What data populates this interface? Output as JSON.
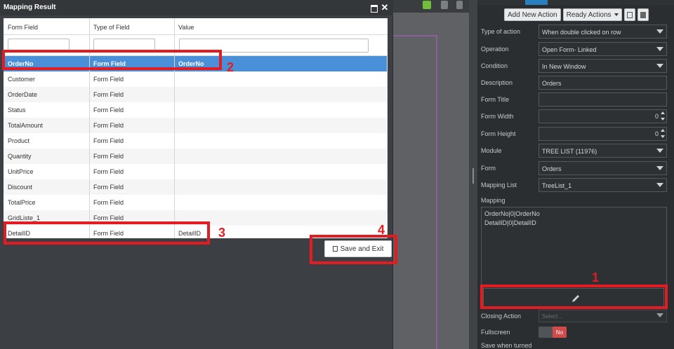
{
  "modal": {
    "title": "Mapping Result",
    "columns": [
      "Form Field",
      "Type of Field",
      "Value"
    ],
    "rows": [
      {
        "field": "OrderNo",
        "type": "Form Field",
        "value": "OrderNo",
        "selected": true
      },
      {
        "field": "Customer",
        "type": "Form Field",
        "value": ""
      },
      {
        "field": "OrderDate",
        "type": "Form Field",
        "value": ""
      },
      {
        "field": "Status",
        "type": "Form Field",
        "value": ""
      },
      {
        "field": "TotalAmount",
        "type": "Form Field",
        "value": ""
      },
      {
        "field": "Product",
        "type": "Form Field",
        "value": ""
      },
      {
        "field": "Quantity",
        "type": "Form Field",
        "value": ""
      },
      {
        "field": "UnitPrice",
        "type": "Form Field",
        "value": ""
      },
      {
        "field": "Discount",
        "type": "Form Field",
        "value": ""
      },
      {
        "field": "TotalPrice",
        "type": "Form Field",
        "value": ""
      },
      {
        "field": "GridListe_1",
        "type": "Form Field",
        "value": ""
      },
      {
        "field": "DetailID",
        "type": "Form Field",
        "value": "DetailID"
      }
    ],
    "save_label": "Save and Exit"
  },
  "panel": {
    "add_action_label": "Add New Action",
    "ready_actions_label": "Ready Actions",
    "props": {
      "type_of_action": {
        "label": "Type of action",
        "value": "When double clicked on row"
      },
      "operation": {
        "label": "Operation",
        "value": "Open Form- Linked"
      },
      "condition": {
        "label": "Condition",
        "value": "In New Window"
      },
      "description": {
        "label": "Description",
        "value": "Orders"
      },
      "form_title": {
        "label": "Form Title",
        "value": ""
      },
      "form_width": {
        "label": "Form Width",
        "value": "0"
      },
      "form_height": {
        "label": "Form Height",
        "value": "0"
      },
      "module": {
        "label": "Module",
        "value": "TREE LIST (11976)"
      },
      "form": {
        "label": "Form",
        "value": "Orders"
      },
      "mapping_list": {
        "label": "Mapping List",
        "value": "TreeList_1"
      }
    },
    "mapping_label": "Mapping",
    "mapping_lines": [
      "OrderNo|0|OrderNo",
      "DetailID|0|DetailID"
    ],
    "closing_action_label": "Closing Action",
    "closing_action_placeholder": "Select...",
    "fullscreen_label": "Fullscreen",
    "fullscreen_toggle": "No",
    "save_when_label": "Save when turned"
  },
  "annotations": [
    "1",
    "2",
    "3",
    "4"
  ],
  "colors": {
    "accent_selection": "#4a90d9",
    "annotation_red": "#e31b23",
    "toggle_no": "#d24b4b"
  }
}
